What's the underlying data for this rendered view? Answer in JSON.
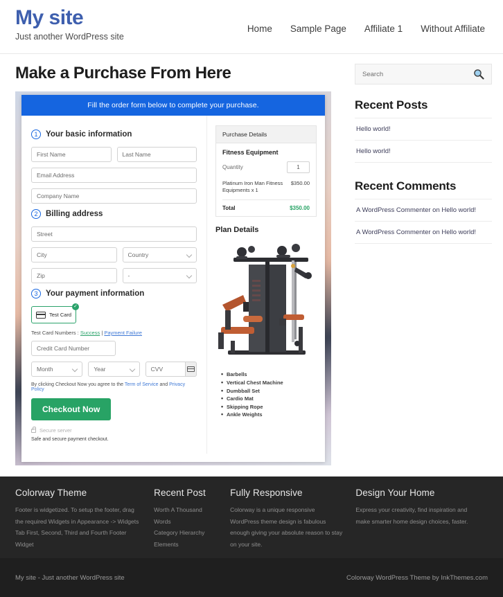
{
  "header": {
    "brand_title": "My site",
    "brand_tagline": "Just another WordPress site",
    "nav": [
      {
        "label": "Home"
      },
      {
        "label": "Sample Page"
      },
      {
        "label": "Affiliate 1"
      },
      {
        "label": "Without Affiliate"
      }
    ]
  },
  "main": {
    "page_title": "Make a Purchase From Here",
    "banner": "Fill the order form below to complete your purchase.",
    "steps": {
      "one": {
        "num": "1",
        "title": "Your basic information"
      },
      "two": {
        "num": "2",
        "title": "Billing address"
      },
      "three": {
        "num": "3",
        "title": "Your payment information"
      }
    },
    "fields": {
      "first_name": "First Name",
      "last_name": "Last Name",
      "email": "Email Address",
      "company": "Company Name",
      "street": "Street",
      "city": "City",
      "country": "Country",
      "zip": "Zip",
      "state": "-",
      "card_number": "Credit Card Number",
      "month": "Month",
      "year": "Year",
      "cvv": "CVV"
    },
    "payment": {
      "card_option": "Test  Card",
      "card_option_badge": "✓",
      "test_numbers_label": "Test Card Numbers :",
      "link_success": "Success",
      "separator": "|",
      "link_failure": "Payment Failure",
      "agree_prefix": "By clicking Checkout Now you agree to the",
      "link_tos": "Term of Service",
      "agree_and": "and",
      "link_privacy": "Privacy Policy",
      "checkout_button": "Checkout Now",
      "secure_server": "Secure server",
      "safe_note": "Safe and secure payment checkout."
    },
    "summary": {
      "head": "Purchase Details",
      "product": "Fitness Equipment",
      "quantity_label": "Quantity",
      "quantity_value": "1",
      "line_item": "Platinum Iron Man Fitness Equipments x 1",
      "line_amount": "$350.00",
      "total_label": "Total",
      "total_amount": "$350.00"
    },
    "plan": {
      "title": "Plan Details",
      "features": [
        "Barbells",
        "Vertical Chest Machine",
        "Dumbball Set",
        "Cardio Mat",
        "Skipping Rope",
        "Ankle Weights"
      ]
    }
  },
  "sidebar": {
    "search_placeholder": "Search",
    "recent_posts": {
      "title": "Recent Posts",
      "items": [
        {
          "label": "Hello world!"
        },
        {
          "label": "Hello world!"
        }
      ]
    },
    "recent_comments": {
      "title": "Recent Comments",
      "items": [
        {
          "label": "A WordPress Commenter on Hello world!"
        },
        {
          "label": "A WordPress Commenter on Hello world!"
        }
      ]
    }
  },
  "footer": {
    "columns": [
      {
        "title": "Colorway Theme",
        "text": "Footer is widgetized. To setup the footer, drag the required Widgets in Appearance -> Widgets Tab First, Second, Third and Fourth Footer Widget",
        "items": []
      },
      {
        "title": "Recent Post",
        "text": "",
        "items": [
          {
            "label": "Worth A Thousand Words"
          },
          {
            "label": "Category Hierarchy"
          },
          {
            "label": "Elements"
          }
        ]
      },
      {
        "title": "Fully Responsive",
        "text": "Colorway is a unique responsive WordPress theme design is fabulous enough giving your absolute reason to stay on your site.",
        "items": []
      },
      {
        "title": "Design Your Home",
        "text": "Express your creativity, find inspiration and make smarter home design choices, faster.",
        "items": []
      }
    ],
    "bottom_left": "My site - Just another WordPress site",
    "bottom_right": "Colorway WordPress Theme by InkThemes.com"
  },
  "colors": {
    "brand_blue": "#3e5fae",
    "banner_blue": "#1565e0",
    "accent_green": "#28a365",
    "footer_dark": "#262626",
    "bottom_dark": "#1f1f1f"
  }
}
